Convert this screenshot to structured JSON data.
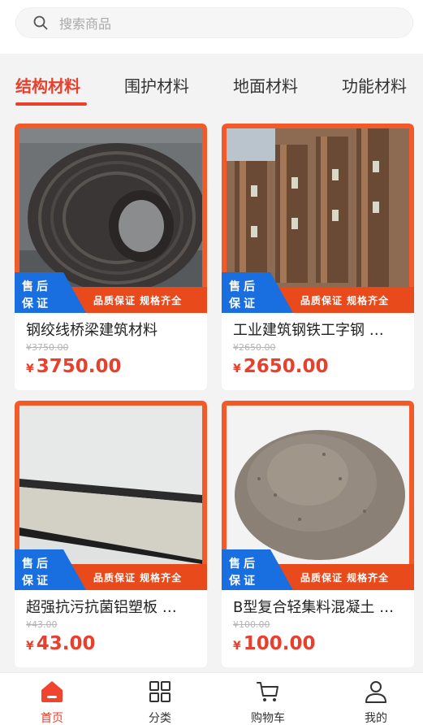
{
  "search": {
    "placeholder": "搜索商品"
  },
  "tabs": [
    {
      "label": "结构材料",
      "active": true
    },
    {
      "label": "围护材料",
      "active": false
    },
    {
      "label": "地面材料",
      "active": false
    },
    {
      "label": "功能材料",
      "active": false
    }
  ],
  "products": [
    {
      "title": "钢绞线桥梁建筑材料",
      "old_price": "¥3750.00",
      "currency": "¥",
      "price": "3750.00",
      "badge_line1": "售后",
      "badge_line2": "保证",
      "banner": "品质保证 规格齐全",
      "image": "steel-strand-coil"
    },
    {
      "title": "工业建筑钢铁工字钢 …",
      "old_price": "¥2650.00",
      "currency": "¥",
      "price": "2650.00",
      "badge_line1": "售后",
      "badge_line2": "保证",
      "banner": "品质保证 规格齐全",
      "image": "h-beam-stack"
    },
    {
      "title": "超强抗污抗菌铝塑板 …",
      "old_price": "¥43.00",
      "currency": "¥",
      "price": "43.00",
      "badge_line1": "售后",
      "badge_line2": "保证",
      "banner": "品质保证 规格齐全",
      "image": "aluminum-composite-panel"
    },
    {
      "title": "B型复合轻集料混凝土 …",
      "old_price": "¥100.00",
      "currency": "¥",
      "price": "100.00",
      "badge_line1": "售后",
      "badge_line2": "保证",
      "banner": "品质保证 规格齐全",
      "image": "concrete-powder-pile"
    }
  ],
  "nav": [
    {
      "label": "首页",
      "icon": "home-icon",
      "active": true
    },
    {
      "label": "分类",
      "icon": "grid-icon",
      "active": false
    },
    {
      "label": "购物车",
      "icon": "cart-icon",
      "active": false
    },
    {
      "label": "我的",
      "icon": "user-icon",
      "active": false
    }
  ],
  "colors": {
    "accent": "#e8402d",
    "frame": "#f25a2a",
    "badge_blue": "#1a6fe0",
    "banner": "#e94a1c"
  }
}
